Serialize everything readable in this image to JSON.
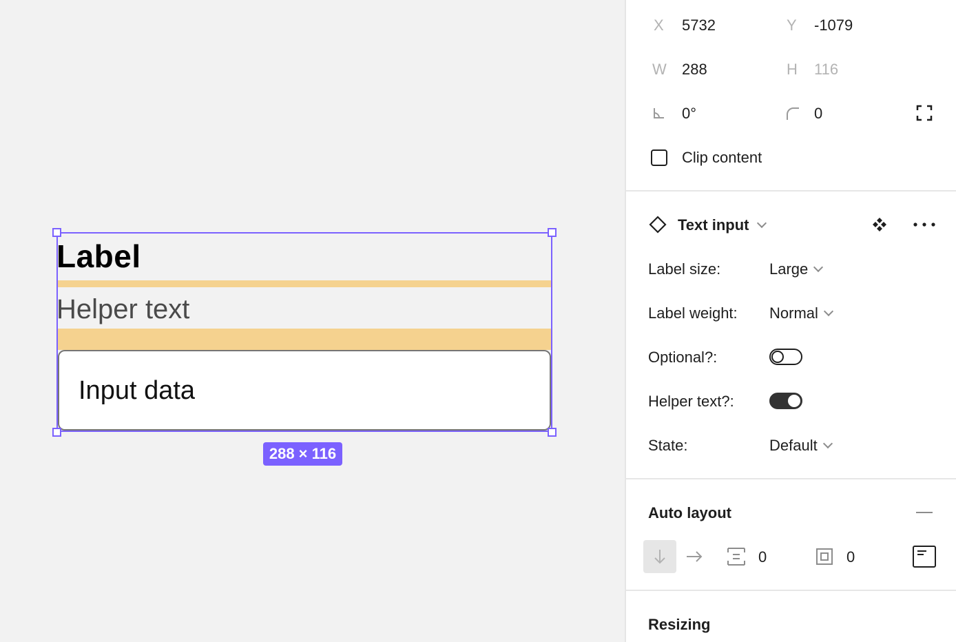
{
  "canvas": {
    "label_text": "Label",
    "helper_text": "Helper text",
    "input_text": "Input data",
    "selection_size": "288 × 116"
  },
  "panel": {
    "position": {
      "x_label": "X",
      "x_value": "5732",
      "y_label": "Y",
      "y_value": "-1079",
      "w_label": "W",
      "w_value": "288",
      "h_label": "H",
      "h_value": "116",
      "rotation_value": "0°",
      "radius_value": "0"
    },
    "clip_content_label": "Clip content",
    "component": {
      "name": "Text input",
      "properties": [
        {
          "label": "Label size:",
          "value": "Large"
        },
        {
          "label": "Label weight:",
          "value": "Normal"
        },
        {
          "label": "Optional?:",
          "toggle": false
        },
        {
          "label": "Helper text?:",
          "toggle": true
        },
        {
          "label": "State:",
          "value": "Default"
        }
      ]
    },
    "auto_layout": {
      "title": "Auto layout",
      "gap_value": "0",
      "padding_value": "0"
    },
    "resizing_title": "Resizing"
  },
  "colors": {
    "selection": "#7b61ff",
    "spacing_band": "#f5d28f",
    "canvas_bg": "#f2f2f2"
  }
}
